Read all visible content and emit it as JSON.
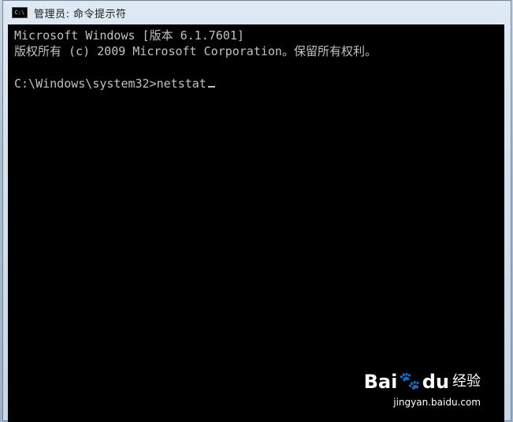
{
  "window": {
    "title": "管理员: 命令提示符",
    "icon": "console-app-icon",
    "icon_text": "C:\\"
  },
  "console": {
    "lines": [
      "Microsoft Windows [版本 6.1.7601]",
      "版权所有 (c) 2009 Microsoft Corporation。保留所有权利。",
      ""
    ],
    "prompt": "C:\\Windows\\system32>",
    "input": "netstat",
    "background": "#000000",
    "foreground": "#c0c0c0"
  },
  "watermark": {
    "logo": "Bai",
    "logo_mark": "du",
    "logo_suffix": "经验",
    "url": "jingyan.baidu.com"
  }
}
